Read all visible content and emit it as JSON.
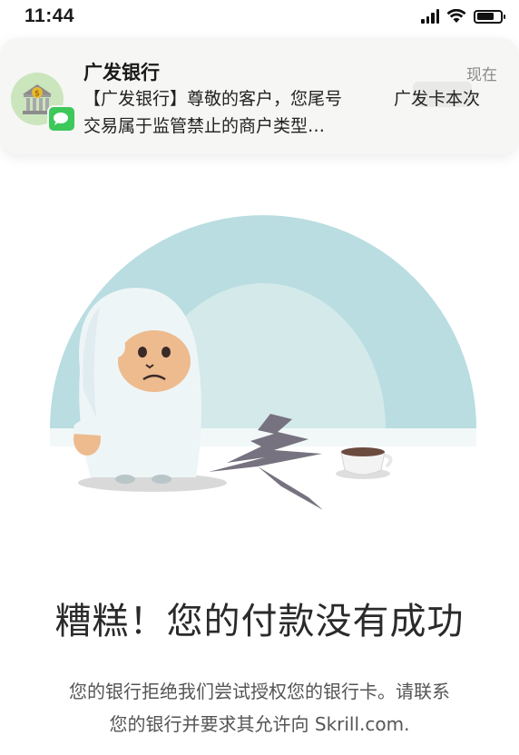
{
  "status_bar": {
    "time": "11:44",
    "battery_level": 0.72
  },
  "notification": {
    "app_name": "广发银行",
    "time": "现在",
    "message": "【广发银行】尊敬的客户，您尾号　　　广发卡本次交易属于监管禁止的商户类型…"
  },
  "error": {
    "headline": "糟糕！您的付款没有成功",
    "description_line1": "您的银行拒绝我们尝试授权您的银行卡。请联系",
    "description_line2": "您的银行并要求其允许向 Skrill.com."
  },
  "colors": {
    "arc_outer": "#b9dde0",
    "arc_inner": "#d3e9ea",
    "snow": "#eef6f7",
    "yeti_face": "#edbb8e",
    "crack": "#77727f",
    "message_badge": "#3dc85a"
  }
}
